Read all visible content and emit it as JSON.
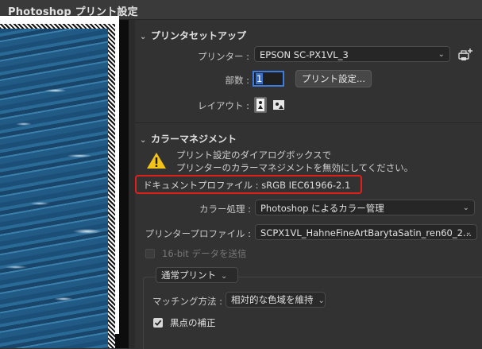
{
  "window": {
    "title": "Photoshop プリント設定"
  },
  "printer_setup": {
    "heading": "プリンタセットアップ",
    "printer_label": "プリンター :",
    "printer_value": "EPSON SC-PX1VL_3",
    "copies_label": "部数 :",
    "copies_value": "1",
    "print_settings_button": "プリント設定...",
    "layout_label": "レイアウト :"
  },
  "color_management": {
    "heading": "カラーマネジメント",
    "warning_line1": "プリント設定のダイアログボックスで",
    "warning_line2": "プリンターのカラーマネジメントを無効にしてください。",
    "document_profile_label": "ドキュメントプロファイル :",
    "document_profile_value": "sRGB IEC61966-2.1",
    "color_handling_label": "カラー処理 :",
    "color_handling_value": "Photoshop によるカラー管理",
    "printer_profile_label": "プリンタープロファイル :",
    "printer_profile_value": "SCPX1VL_HahneFineArtBarytaSatin_ren60_2...",
    "sixteen_bit_label": "16-bit データを送信",
    "sixteen_bit_checked": false,
    "print_mode_value": "通常プリント",
    "rendering_intent_label": "マッチング方法 :",
    "rendering_intent_value": "相対的な色域を維持",
    "black_point_label": "黒点の補正",
    "black_point_checked": true
  },
  "icons": {
    "add_printer": "add-printer-icon",
    "portrait": "portrait-orientation-icon",
    "landscape": "landscape-orientation-icon",
    "warning": "warning-icon"
  },
  "colors": {
    "highlight_box": "#e0201a",
    "focus_ring": "#3d7be0"
  }
}
